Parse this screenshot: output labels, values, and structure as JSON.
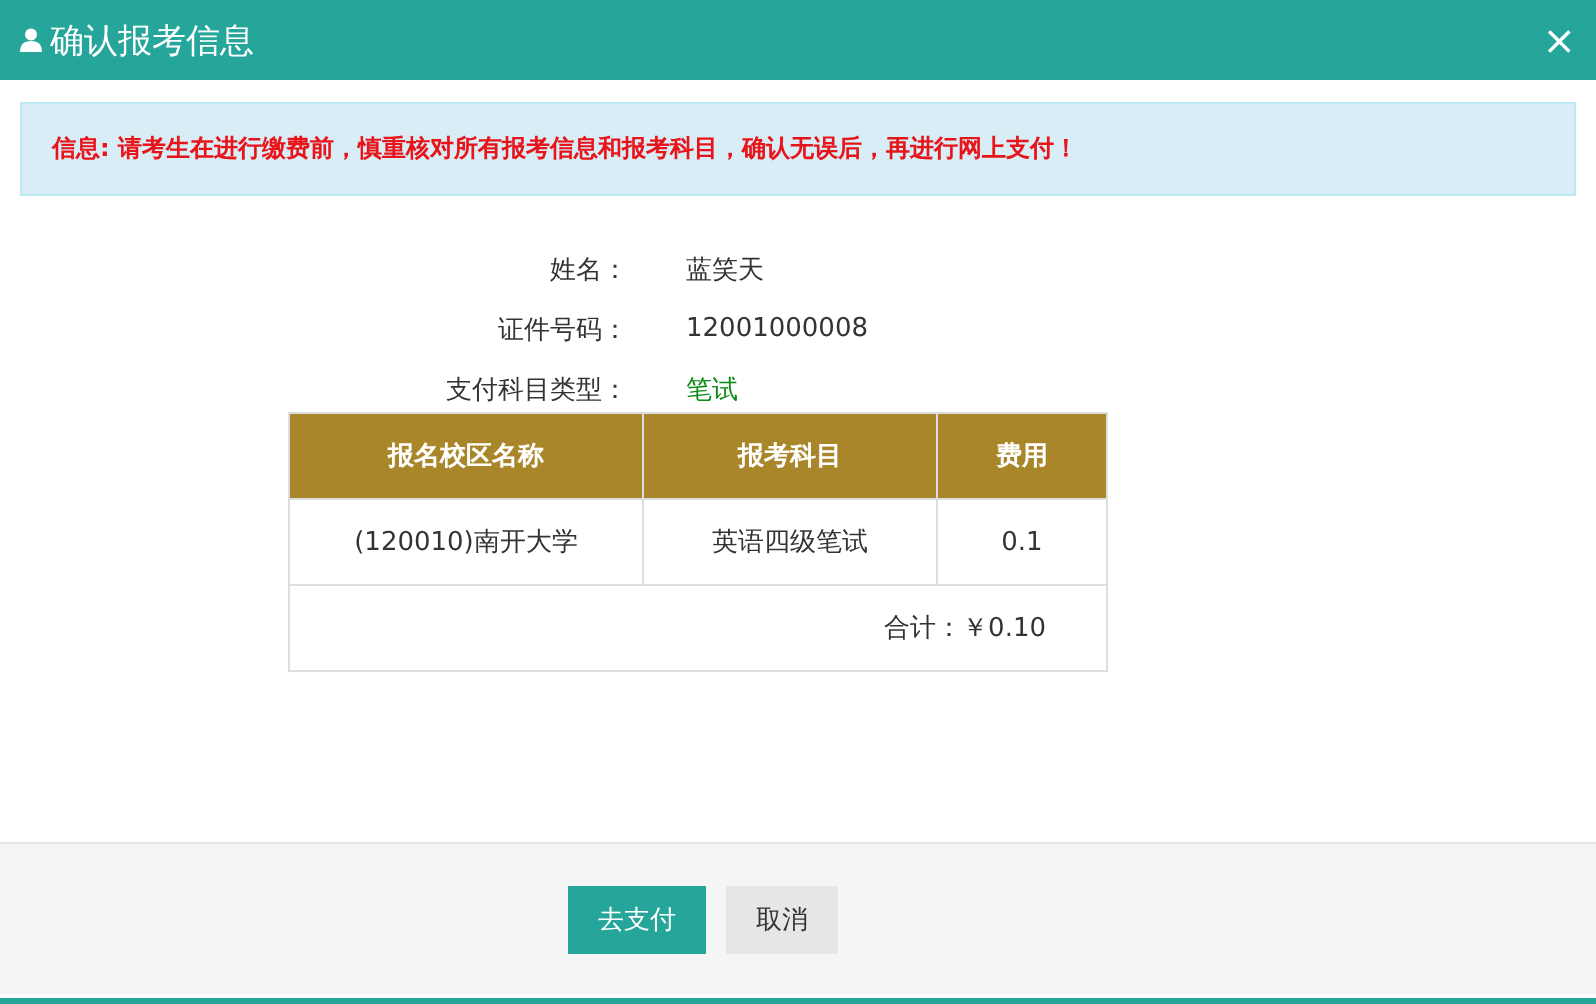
{
  "window": {
    "title": "确认报考信息",
    "close": "×"
  },
  "alert": "信息: 请考生在进行缴费前，慎重核对所有报考信息和报考科目，确认无误后，再进行网上支付！",
  "fields": [
    {
      "label": "姓名：",
      "value": "蓝笑天",
      "kind": "plain"
    },
    {
      "label": "证件号码：",
      "value": "12001000008",
      "kind": "plain"
    },
    {
      "label": "支付科目类型：",
      "value": "笔试",
      "kind": "highlight"
    }
  ],
  "table": {
    "columns": [
      "报名校区名称",
      "报考科目",
      "费用"
    ],
    "rows": [
      [
        "(120010)南开大学",
        "英语四级笔试",
        "0.1"
      ]
    ],
    "total": "合计：￥0.10"
  },
  "buttons": [
    {
      "label": "去支付",
      "kind": "primary"
    },
    {
      "label": "取消",
      "kind": "default"
    }
  ]
}
